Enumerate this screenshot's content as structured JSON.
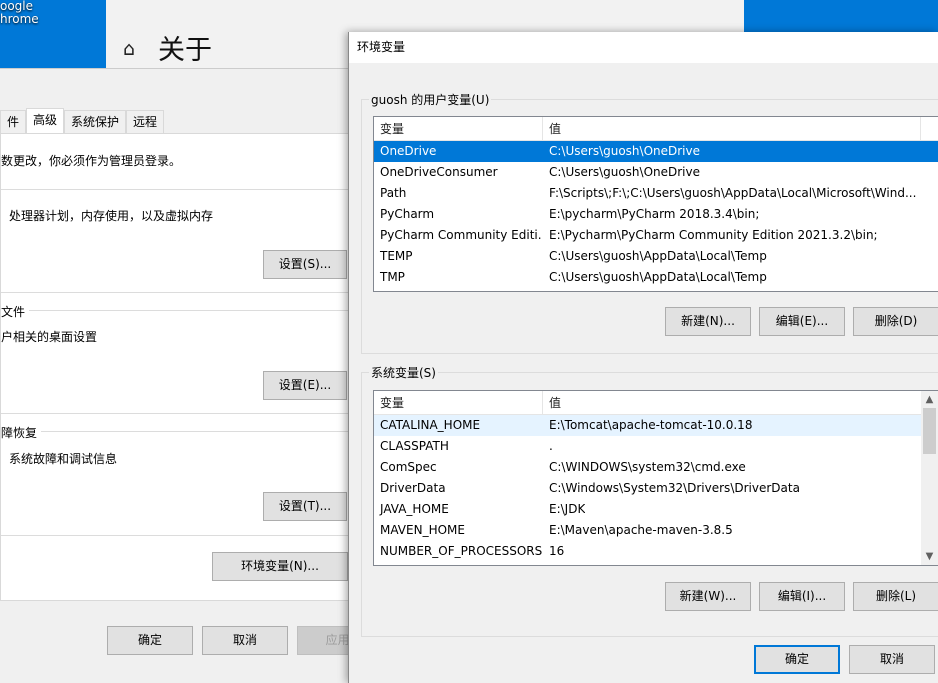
{
  "desktop": {
    "icon_label_line1": "oogle",
    "icon_label_line2": "hrome"
  },
  "settings": {
    "title": "关于"
  },
  "sysprops": {
    "tabs": [
      "件",
      "高级",
      "系统保护",
      "远程"
    ],
    "admin_note": "数更改，你必须作为管理员登录。",
    "perf_desc": "处理器计划，内存使用，以及虚拟内存",
    "perf_settings": "设置(S)...",
    "profile_group": "文件",
    "profile_desc": "户相关的桌面设置",
    "profile_settings": "设置(E)...",
    "recovery_group": "障恢复",
    "recovery_desc": "系统故障和调试信息",
    "recovery_settings": "设置(T)...",
    "env_button": "环境变量(N)...",
    "ok": "确定",
    "cancel": "取消",
    "apply": "应用("
  },
  "env": {
    "title": "环境变量",
    "user_group": "guosh 的用户变量(U)",
    "col_var": "变量",
    "col_val": "值",
    "user_vars": [
      {
        "name": "OneDrive",
        "value": "C:\\Users\\guosh\\OneDrive"
      },
      {
        "name": "OneDriveConsumer",
        "value": "C:\\Users\\guosh\\OneDrive"
      },
      {
        "name": "Path",
        "value": "F:\\Scripts\\;F:\\;C:\\Users\\guosh\\AppData\\Local\\Microsoft\\Wind..."
      },
      {
        "name": "PyCharm",
        "value": "E:\\pycharm\\PyCharm 2018.3.4\\bin;"
      },
      {
        "name": "PyCharm Community Editi...",
        "value": "E:\\Pycharm\\PyCharm Community Edition 2021.3.2\\bin;"
      },
      {
        "name": "TEMP",
        "value": "C:\\Users\\guosh\\AppData\\Local\\Temp"
      },
      {
        "name": "TMP",
        "value": "C:\\Users\\guosh\\AppData\\Local\\Temp"
      }
    ],
    "user_new": "新建(N)...",
    "user_edit": "编辑(E)...",
    "user_delete": "删除(D)",
    "sys_group": "系统变量(S)",
    "sys_vars": [
      {
        "name": "CATALINA_HOME",
        "value": "E:\\Tomcat\\apache-tomcat-10.0.18"
      },
      {
        "name": "CLASSPATH",
        "value": "."
      },
      {
        "name": "ComSpec",
        "value": "C:\\WINDOWS\\system32\\cmd.exe"
      },
      {
        "name": "DriverData",
        "value": "C:\\Windows\\System32\\Drivers\\DriverData"
      },
      {
        "name": "JAVA_HOME",
        "value": "E:\\JDK"
      },
      {
        "name": "MAVEN_HOME",
        "value": "E:\\Maven\\apache-maven-3.8.5"
      },
      {
        "name": "NUMBER_OF_PROCESSORS",
        "value": "16"
      }
    ],
    "sys_new": "新建(W)...",
    "sys_edit": "编辑(I)...",
    "sys_delete": "删除(L)",
    "ok": "确定",
    "cancel": "取消"
  }
}
